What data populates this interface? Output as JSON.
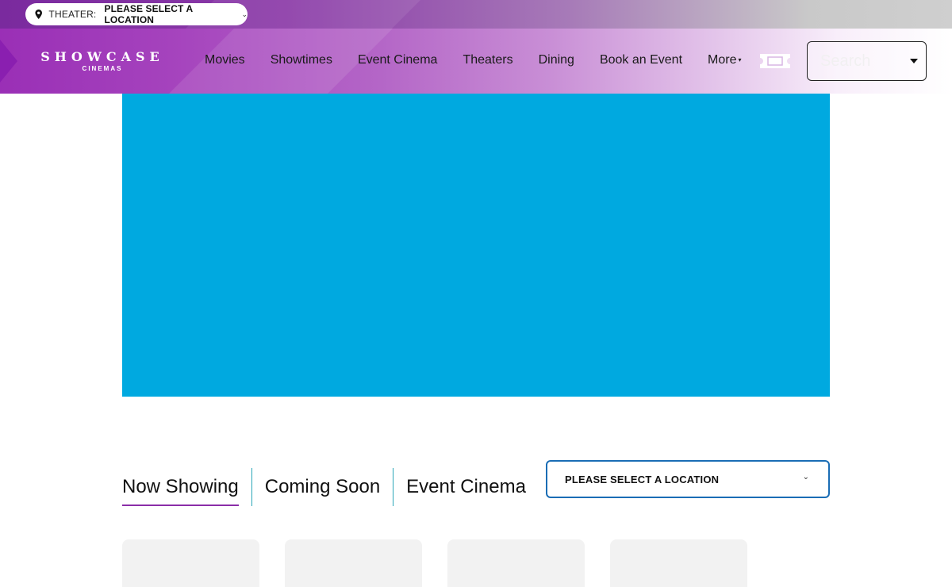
{
  "theater_bar": {
    "label": "THEATER:",
    "value": "PLEASE SELECT A LOCATION",
    "icon": "map-pin-icon"
  },
  "brand": {
    "logo_main": "SHOWCASE",
    "logo_sub": "CINEMAS"
  },
  "nav": {
    "items": [
      {
        "label": "Movies"
      },
      {
        "label": "Showtimes"
      },
      {
        "label": "Event Cinema"
      },
      {
        "label": "Theaters"
      },
      {
        "label": "Dining"
      },
      {
        "label": "Book an Event"
      },
      {
        "label": "More"
      }
    ],
    "search_placeholder": "Search"
  },
  "tabs": [
    {
      "label": "Now Showing",
      "active": true
    },
    {
      "label": "Coming Soon",
      "active": false
    },
    {
      "label": "Event Cinema",
      "active": false
    }
  ],
  "location_select": {
    "value": "PLEASE SELECT A LOCATION"
  },
  "colors": {
    "accent_purple": "#8b2da8",
    "hero_blue": "#00a9e0",
    "select_border": "#1a6db5",
    "tab_divider": "#2aa6b8"
  }
}
